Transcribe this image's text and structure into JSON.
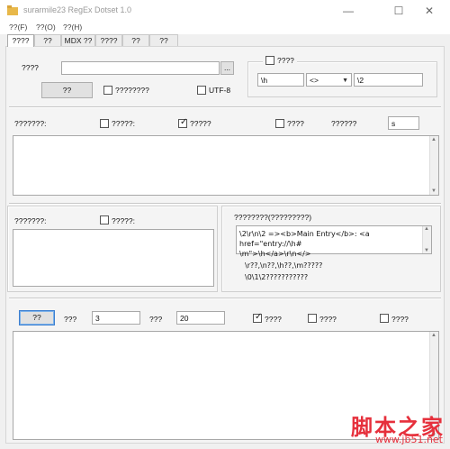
{
  "window": {
    "title": "surarmile23 RegEx Dotset 1.0",
    "minimize": "—",
    "maximize": "☐",
    "close": "✕"
  },
  "menu": [
    "??(F)",
    "??(O)",
    "??(H)"
  ],
  "tabs": [
    "????",
    "??",
    "MDX ??",
    "????",
    "??",
    "??"
  ],
  "top": {
    "file_label": "????",
    "file_value": "",
    "browse_label": "...",
    "go_label": "??",
    "opt1_label": "????????",
    "utf8_label": "UTF-8",
    "group_chk_label": "????",
    "field1_value": "\\h",
    "combo_value": "<>",
    "field2_value": "\\2"
  },
  "middle": {
    "label1": "???????:",
    "chk1_label": "?????:",
    "chk2_label": "?????",
    "chk3_label": "????",
    "label2": "??????",
    "num_value": "s"
  },
  "lower_left": {
    "label": "???????:",
    "chk_label": "?????:"
  },
  "lower_right": {
    "group_title": "????????(?????????)",
    "example_line1": "\\2\\r\\n\\2 =><b>Main Entry</b>: <a href=\"entry://\\h#",
    "example_line2": "\\m\">\\h</a>\\r\\n</>",
    "note1": "\\r??,\\n??,\\h??,\\m?????",
    "note2": "\\0\\1\\2???????????"
  },
  "bottom": {
    "go_label": "??",
    "label1": "???",
    "val1": "3",
    "label2": "???",
    "val2": "20",
    "chk1_label": "????",
    "chk2_label": "????",
    "chk3_label": "????"
  },
  "watermark": {
    "text": "脚本之家",
    "url": "www.jb51.net"
  }
}
